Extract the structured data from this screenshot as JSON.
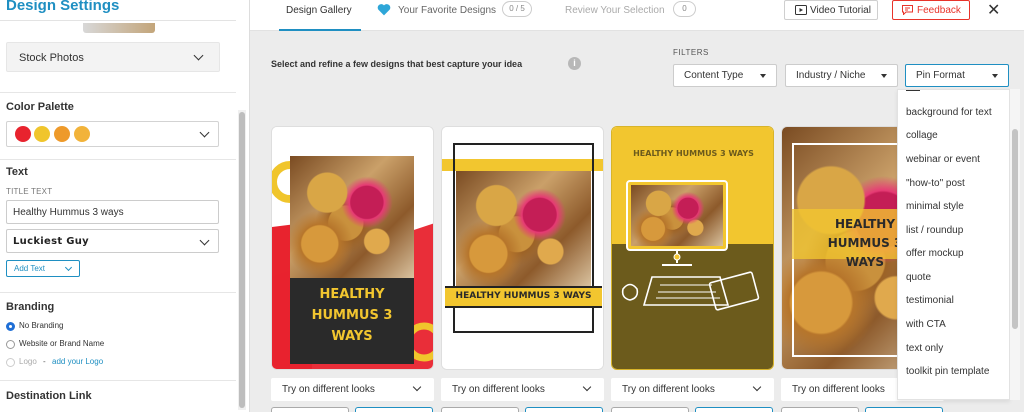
{
  "sidebar": {
    "title": "Design Settings",
    "stock_label": "Stock Photos",
    "palette_heading": "Color Palette",
    "palette_colors": [
      "#e8232e",
      "#f0c52c",
      "#ee9a2a",
      "#f2b33a"
    ],
    "text_heading": "Text",
    "title_text_caption": "TITLE TEXT",
    "title_text_value": "Healthy Hummus 3 ways",
    "font_value": "Luckiest Guy",
    "add_text_label": "Add Text",
    "branding_heading": "Branding",
    "branding_options": [
      "No Branding",
      "Website or Brand Name",
      "Logo"
    ],
    "branding_selected": "No Branding",
    "logo_separator": "-",
    "add_logo_link": "add your Logo",
    "destination_heading": "Destination Link"
  },
  "topbar": {
    "tab_gallery": "Design Gallery",
    "tab_favorites": "Your Favorite Designs",
    "favorites_count": "0 / 5",
    "tab_review": "Review Your Selection",
    "review_count": "0",
    "video_tutorial": "Video Tutorial",
    "feedback": "Feedback",
    "close_glyph": "✕"
  },
  "main": {
    "instruction": "Select and refine a few designs that best capture your idea",
    "info_glyph": "i",
    "filters_label": "FILTERS",
    "filter_content_type": "Content Type",
    "filter_industry": "Industry / Niche",
    "filter_pin_format": "Pin Format",
    "try_looks_label": "Try on different looks",
    "card_texts": {
      "card1": "HEALTHY HUMMUS 3 WAYS",
      "card2": "HEALTHY HUMMUS 3 WAYS",
      "card3": "HEALTHY HUMMUS 3 WAYS",
      "card4": "HEALTHY HUMMUS 3 WAYS"
    }
  },
  "pin_format_options": [
    "background for text",
    "collage",
    "webinar or event",
    "\"how-to\" post",
    "minimal style",
    "list / roundup",
    "offer mockup",
    "quote",
    "testimonial",
    "with CTA",
    "text only",
    "toolkit pin template"
  ],
  "colors": {
    "accent": "#1f8fc2",
    "feedback_red": "#e8332a",
    "favorite_heart": "#2ea6d8",
    "card_yellow": "#f2c62f",
    "card_olive": "#6c5b1c",
    "card_red": "#e8232e",
    "card_dark": "#2a2a2a"
  }
}
